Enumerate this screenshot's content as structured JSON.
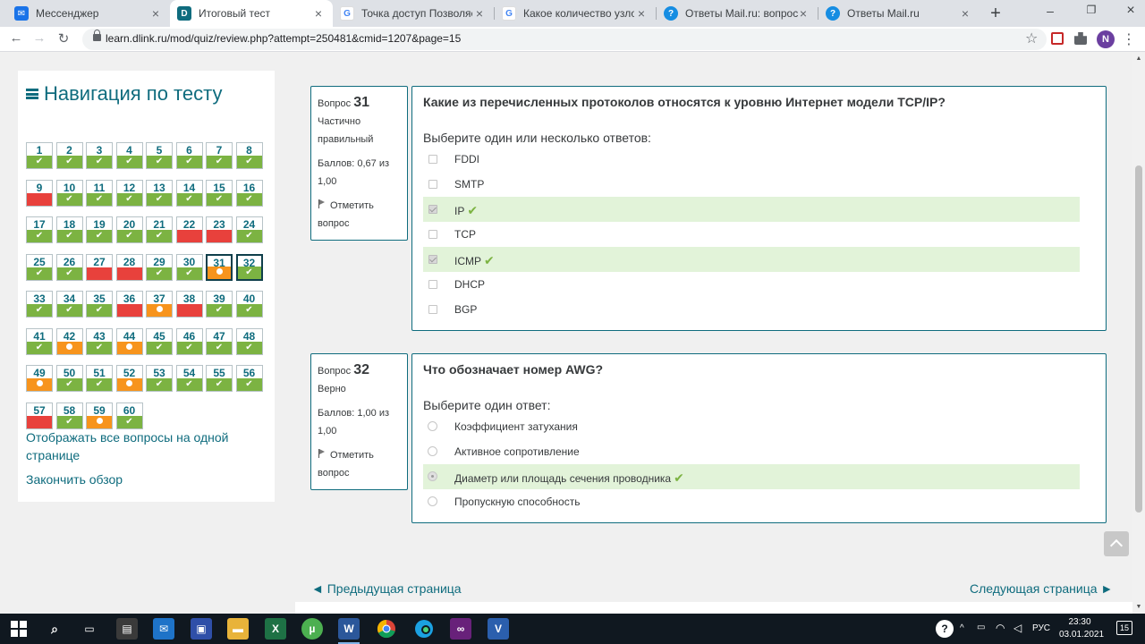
{
  "browser": {
    "tabs": [
      {
        "title": "Мессенджер",
        "icon": "messenger-icon",
        "color": "#1a73e8",
        "active": false
      },
      {
        "title": "Итоговый тест",
        "icon": "dlink-icon",
        "color": "#0f6c7e",
        "active": true
      },
      {
        "title": "Точка доступ Позволяет об",
        "icon": "google-icon",
        "color": "#4285f4",
        "active": false
      },
      {
        "title": "Какое количество узлов до",
        "icon": "google-icon",
        "color": "#4285f4",
        "active": false
      },
      {
        "title": "Ответы Mail.ru: вопрос",
        "icon": "mailru-answers-icon",
        "color": "#168de2",
        "active": false
      },
      {
        "title": "Ответы Mail.ru",
        "icon": "mailru-answers-icon",
        "color": "#168de2",
        "active": false
      }
    ],
    "url": "learn.dlink.ru/mod/quiz/review.php?attempt=250481&cmid=1207&page=15",
    "profile_initial": "N"
  },
  "nav": {
    "title": "Навигация по тесту",
    "questions": [
      {
        "n": "1",
        "s": "correct"
      },
      {
        "n": "2",
        "s": "correct"
      },
      {
        "n": "3",
        "s": "correct"
      },
      {
        "n": "4",
        "s": "correct"
      },
      {
        "n": "5",
        "s": "correct"
      },
      {
        "n": "6",
        "s": "correct"
      },
      {
        "n": "7",
        "s": "correct"
      },
      {
        "n": "8",
        "s": "correct"
      },
      {
        "n": "9",
        "s": "incorrect"
      },
      {
        "n": "10",
        "s": "correct"
      },
      {
        "n": "11",
        "s": "correct"
      },
      {
        "n": "12",
        "s": "correct"
      },
      {
        "n": "13",
        "s": "correct"
      },
      {
        "n": "14",
        "s": "correct"
      },
      {
        "n": "15",
        "s": "correct"
      },
      {
        "n": "16",
        "s": "correct"
      },
      {
        "n": "17",
        "s": "correct"
      },
      {
        "n": "18",
        "s": "correct"
      },
      {
        "n": "19",
        "s": "correct"
      },
      {
        "n": "20",
        "s": "correct"
      },
      {
        "n": "21",
        "s": "correct"
      },
      {
        "n": "22",
        "s": "incorrect"
      },
      {
        "n": "23",
        "s": "incorrect"
      },
      {
        "n": "24",
        "s": "correct"
      },
      {
        "n": "25",
        "s": "correct"
      },
      {
        "n": "26",
        "s": "correct"
      },
      {
        "n": "27",
        "s": "incorrect"
      },
      {
        "n": "28",
        "s": "incorrect"
      },
      {
        "n": "29",
        "s": "correct"
      },
      {
        "n": "30",
        "s": "correct"
      },
      {
        "n": "31",
        "s": "partial",
        "current": true
      },
      {
        "n": "32",
        "s": "correct",
        "current": true
      },
      {
        "n": "33",
        "s": "correct"
      },
      {
        "n": "34",
        "s": "correct"
      },
      {
        "n": "35",
        "s": "correct"
      },
      {
        "n": "36",
        "s": "incorrect"
      },
      {
        "n": "37",
        "s": "partial"
      },
      {
        "n": "38",
        "s": "incorrect"
      },
      {
        "n": "39",
        "s": "correct"
      },
      {
        "n": "40",
        "s": "correct"
      },
      {
        "n": "41",
        "s": "correct"
      },
      {
        "n": "42",
        "s": "partial"
      },
      {
        "n": "43",
        "s": "correct"
      },
      {
        "n": "44",
        "s": "partial"
      },
      {
        "n": "45",
        "s": "correct"
      },
      {
        "n": "46",
        "s": "correct"
      },
      {
        "n": "47",
        "s": "correct"
      },
      {
        "n": "48",
        "s": "correct"
      },
      {
        "n": "49",
        "s": "partial"
      },
      {
        "n": "50",
        "s": "correct"
      },
      {
        "n": "51",
        "s": "correct"
      },
      {
        "n": "52",
        "s": "partial"
      },
      {
        "n": "53",
        "s": "correct"
      },
      {
        "n": "54",
        "s": "correct"
      },
      {
        "n": "55",
        "s": "correct"
      },
      {
        "n": "56",
        "s": "correct"
      },
      {
        "n": "57",
        "s": "incorrect"
      },
      {
        "n": "58",
        "s": "correct"
      },
      {
        "n": "59",
        "s": "partial"
      },
      {
        "n": "60",
        "s": "correct"
      }
    ],
    "show_all_link": "Отображать все вопросы на одной странице",
    "finish_link": "Закончить обзор"
  },
  "q31": {
    "label": "Вопрос",
    "number": "31",
    "state": "Частично правильный",
    "grade": "Баллов: 0,67 из 1,00",
    "flag": "Отметить вопрос",
    "text": "Какие из перечисленных протоколов относятся к уровню Интернет модели TCP/IP?",
    "prompt": "Выберите один или несколько ответов:",
    "answers": [
      {
        "label": "FDDI",
        "checked": false,
        "correct": false
      },
      {
        "label": "SMTP",
        "checked": false,
        "correct": false
      },
      {
        "label": "IP",
        "checked": true,
        "correct": true
      },
      {
        "label": "TCP",
        "checked": false,
        "correct": false
      },
      {
        "label": "ICMP",
        "checked": true,
        "correct": true
      },
      {
        "label": "DHCP",
        "checked": false,
        "correct": false
      },
      {
        "label": "BGP",
        "checked": false,
        "correct": false
      }
    ]
  },
  "q32": {
    "label": "Вопрос",
    "number": "32",
    "state": "Верно",
    "grade": "Баллов: 1,00 из 1,00",
    "flag": "Отметить вопрос",
    "text": "Что обозначает номер AWG?",
    "prompt": "Выберите один ответ:",
    "answers": [
      {
        "label": "Коэффициент затухания",
        "checked": false,
        "correct": false
      },
      {
        "label": "Активное сопротивление",
        "checked": false,
        "correct": false
      },
      {
        "label": "Диаметр или площадь сечения проводника",
        "checked": true,
        "correct": true
      },
      {
        "label": "Пропускную способность",
        "checked": false,
        "correct": false
      }
    ]
  },
  "pager": {
    "prev": "◄ Предыдущая страница",
    "next": "Следующая страница ►"
  },
  "taskbar": {
    "lang": "РУС",
    "time": "23:30",
    "date": "03.01.2021",
    "notifications": "15"
  },
  "colors": {
    "accent": "#0f6c7e",
    "correct": "#7cb342",
    "incorrect": "#e8413c",
    "partial": "#f7941d"
  }
}
